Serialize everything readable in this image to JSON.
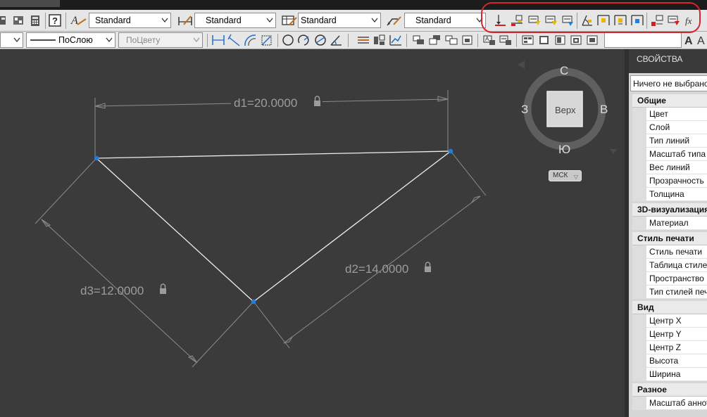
{
  "toolbar_top": {
    "combos": [
      "Standard",
      "Standard",
      "Standard",
      "Standard"
    ]
  },
  "toolbar_props": {
    "linetype": "ПоСлою",
    "plotstyle": "ПоЦвету"
  },
  "drawing": {
    "dimensions": [
      "d1=20.0000",
      "d2=14.0000",
      "d3=12.0000"
    ]
  },
  "viewcube": {
    "face": "Верх",
    "north": "С",
    "south": "Ю",
    "west": "З",
    "east": "В",
    "ucs": "МСК"
  },
  "properties_panel": {
    "title": "СВОЙСТВА",
    "selection": "Ничего не выбрано",
    "sections": [
      {
        "name": "Общие",
        "rows": [
          "Цвет",
          "Слой",
          "Тип линий",
          "Масштаб типа линий",
          "Вес линий",
          "Прозрачность",
          "Толщина"
        ]
      },
      {
        "name": "3D-визуализация",
        "rows": [
          "Материал"
        ]
      },
      {
        "name": "Стиль печати",
        "rows": [
          "Стиль печати",
          "Таблица стилей печати",
          "Пространство",
          "Тип стилей печати"
        ]
      },
      {
        "name": "Вид",
        "rows": [
          "Центр X",
          "Центр Y",
          "Центр Z",
          "Высота",
          "Ширина"
        ]
      },
      {
        "name": "Разное",
        "rows": [
          "Масштаб аннотаций"
        ]
      }
    ]
  },
  "colors": {
    "canvas": "#3b3b3b",
    "highlight": "#d8232a",
    "grip": "#1e7fe0"
  }
}
